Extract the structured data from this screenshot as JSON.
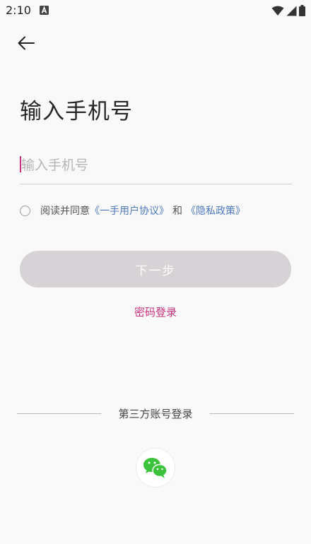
{
  "status_bar": {
    "time": "2:10",
    "left_icon": "a-notification-icon",
    "right_icons": [
      "wifi-icon",
      "signal-icon",
      "battery-icon"
    ]
  },
  "nav": {
    "back_icon": "back-arrow-icon"
  },
  "title": "输入手机号",
  "phone_input": {
    "placeholder": "输入手机号",
    "value": ""
  },
  "agreement": {
    "prefix": "阅读并同意",
    "user_agreement_link": "《一手用户协议》",
    "conjunction": "和",
    "privacy_link": "《隐私政策》",
    "checked": false
  },
  "next_button": {
    "label": "下一步"
  },
  "password_login": {
    "label": "密码登录"
  },
  "third_party": {
    "label": "第三方账号登录",
    "providers": [
      {
        "icon": "wechat-icon"
      }
    ]
  },
  "colors": {
    "accent": "#c8327d",
    "link": "#4e79bf",
    "button_disabled": "#d7d2d5",
    "wechat_green": "#3ac23a"
  }
}
